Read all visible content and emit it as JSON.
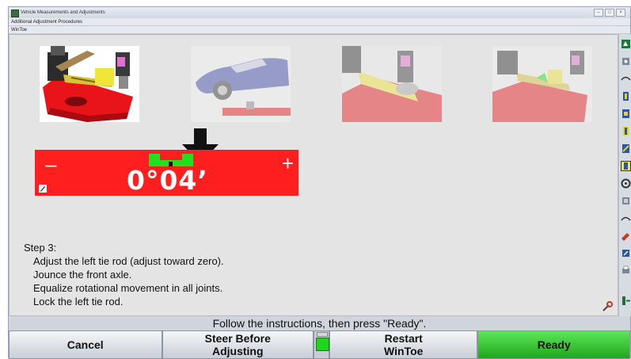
{
  "window": {
    "title": "Vehicle Measurements and Adjustments",
    "breadcrumb1": "Additional Adjustment Procedures",
    "breadcrumb2": "WinToe",
    "controls": [
      "–",
      "□",
      "×"
    ]
  },
  "procedure": {
    "thumbnails": [
      {
        "name": "tie-rod-closeup",
        "faded": false
      },
      {
        "name": "vehicle-on-lift",
        "faded": true
      },
      {
        "name": "tie-rod-adjust",
        "faded": true
      },
      {
        "name": "tie-rod-lock",
        "faded": true
      }
    ]
  },
  "gauge": {
    "minus_label": "–",
    "plus_label": "+",
    "reading": "0°04’",
    "color": "#ff1f1f",
    "in_tolerance_color": "#22e01e"
  },
  "step": {
    "heading": "Step 3:",
    "lines": [
      "Adjust the left tie rod (adjust toward zero).",
      "Jounce the front axle.",
      "Equalize rotational movement in all joints.",
      "Lock the left tie rod."
    ]
  },
  "instruction": "Follow the instructions, then press \"Ready\".",
  "buttons": {
    "cancel": "Cancel",
    "steer_before_adjusting": "Steer Before\nAdjusting",
    "restart_wintoe": "Restart\nWinToe",
    "ready": "Ready"
  },
  "sidebar_icons": [
    "alignment-icon",
    "camera-icon",
    "ride-height-icon",
    "caster-icon",
    "camber-icon",
    "toe-icon",
    "sai-icon",
    "toe-selected-icon",
    "wheel-icon",
    "steer-icon",
    "turn-icon",
    "tools-icon",
    "jack-icon",
    "print-icon",
    "exit-icon"
  ]
}
